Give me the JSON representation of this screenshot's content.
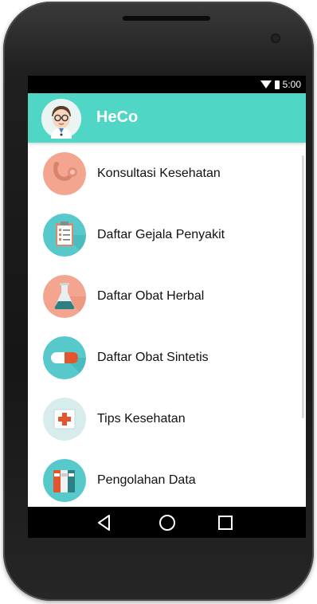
{
  "status": {
    "time": "5:00",
    "wifi_icon": "wifi-icon",
    "battery_icon": "battery-icon"
  },
  "appbar": {
    "title": "HeCo",
    "color": "#4fd6c4",
    "avatar_icon": "doctor-avatar-icon"
  },
  "menu": {
    "items": [
      {
        "label": "Konsultasi Kesehatan",
        "icon": "stethoscope-icon",
        "bg": "#f3a58f"
      },
      {
        "label": "Daftar Gejala Penyakit",
        "icon": "clipboard-icon",
        "bg": "#57c9ca"
      },
      {
        "label": "Daftar Obat Herbal",
        "icon": "flask-icon",
        "bg": "#f3a58f"
      },
      {
        "label": "Daftar Obat Sintetis",
        "icon": "pill-icon",
        "bg": "#57c9ca"
      },
      {
        "label": "Tips Kesehatan",
        "icon": "first-aid-icon",
        "bg": "#d7ecec"
      },
      {
        "label": "Pengolahan Data",
        "icon": "binders-icon",
        "bg": "#57c9ca"
      }
    ]
  },
  "navbar": {
    "back_icon": "back-icon",
    "home_icon": "home-icon",
    "recents_icon": "recents-icon"
  }
}
